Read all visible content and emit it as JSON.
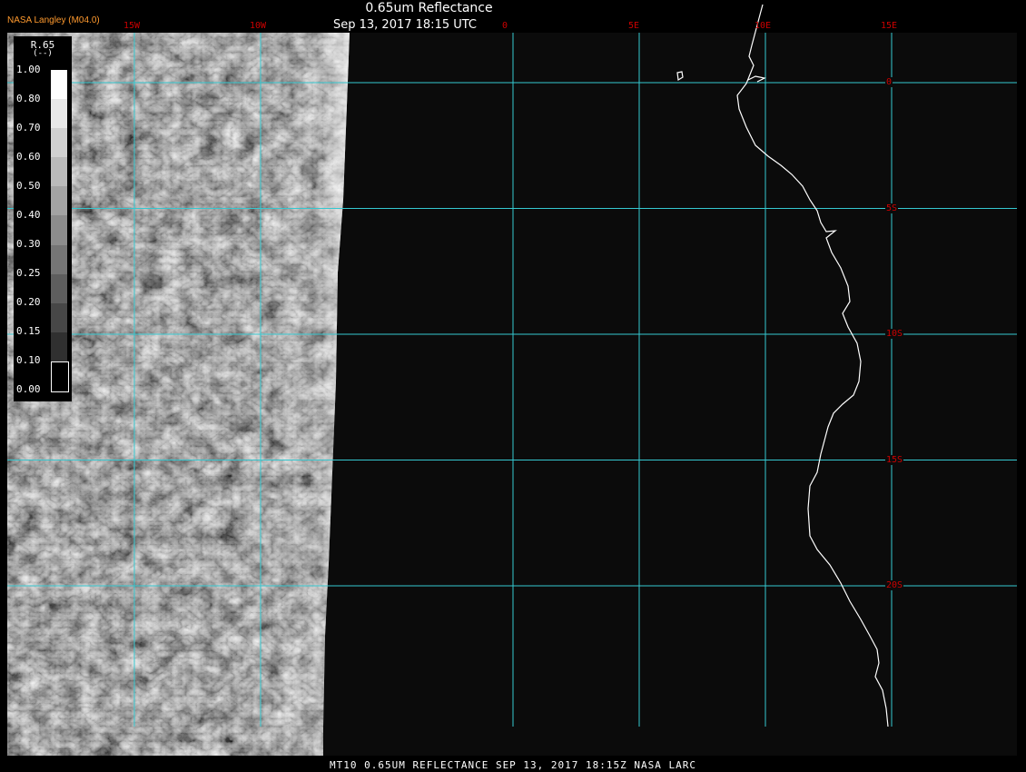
{
  "header": {
    "title": "0.65um Reflectance",
    "subtitle": "Sep 13, 2017 18:15 UTC",
    "provider": "NASA Langley (M04.0)"
  },
  "footer": {
    "text": "MT10  0.65UM REFLECTANCE   SEP 13, 2017 18:15Z   NASA LARC"
  },
  "legend": {
    "title": "R.65",
    "units": "(--)",
    "ticks": [
      "1.00",
      "0.80",
      "0.70",
      "0.60",
      "0.50",
      "0.40",
      "0.30",
      "0.25",
      "0.20",
      "0.15",
      "0.10",
      "0.00"
    ]
  },
  "grid": {
    "line_color": "#35c8d0",
    "label_color": "#cc0000",
    "longitudes": [
      {
        "label": "15W",
        "value": -15
      },
      {
        "label": "10W",
        "value": -10
      },
      {
        "label": "0",
        "value": 0
      },
      {
        "label": "5E",
        "value": 5
      },
      {
        "label": "10E",
        "value": 10
      },
      {
        "label": "15E",
        "value": 15
      }
    ],
    "latitudes": [
      {
        "label": "0",
        "value": 0
      },
      {
        "label": "5S",
        "value": -5
      },
      {
        "label": "10S",
        "value": -10
      },
      {
        "label": "15S",
        "value": -15
      },
      {
        "label": "20S",
        "value": -20
      }
    ]
  }
}
